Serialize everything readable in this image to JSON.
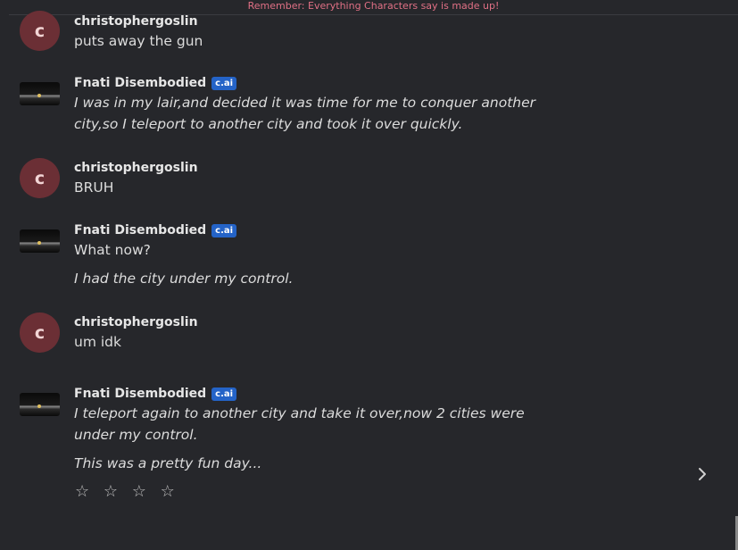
{
  "disclaimer": "Remember: Everything Characters say is made up!",
  "badge": "c.ai",
  "messages": [
    {
      "name": "christophergoslin",
      "avatar": "c",
      "text": "puts away the gun"
    },
    {
      "name": "Fnati Disembodied",
      "text": "I was in my lair,and decided it was time for me to conquer another city,so I teleport to another city and took it over quickly."
    },
    {
      "name": "christophergoslin",
      "avatar": "c",
      "text": "BRUH"
    },
    {
      "name": "Fnati Disembodied",
      "text": "What now?",
      "text2": "I had the city under my control."
    },
    {
      "name": "christophergoslin",
      "avatar": "c",
      "text": "um idk"
    },
    {
      "name": "Fnati Disembodied",
      "text": "I teleport again to another city and take it over,now 2 cities were under my control.",
      "text2": "This was a pretty fun day..."
    }
  ],
  "rating": {
    "stars": [
      "☆",
      "☆",
      "☆",
      "☆"
    ],
    "value": 0
  },
  "icons": {
    "next": "chevron-right-icon"
  },
  "colors": {
    "background": "#26272b",
    "user_avatar": "#6b2f35",
    "badge": "#2463c7",
    "disclaimer": "#e07085"
  }
}
